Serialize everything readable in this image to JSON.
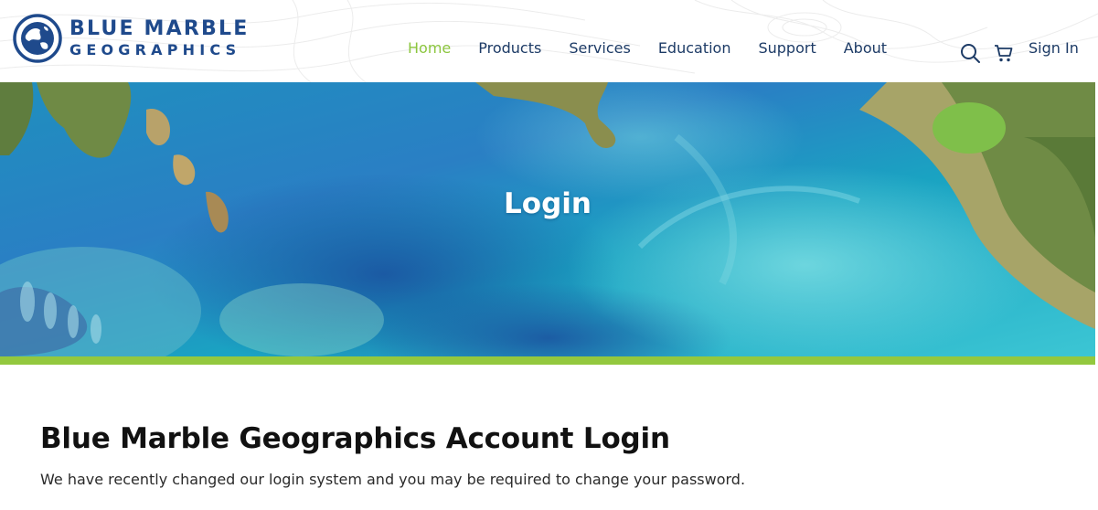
{
  "brand": {
    "logo_line1": "BLUE MARBLE",
    "logo_line2": "GEOGRAPHICS",
    "logo_color": "#1f4a8c"
  },
  "nav": {
    "items": [
      {
        "label": "Home",
        "active": true
      },
      {
        "label": "Products",
        "active": false
      },
      {
        "label": "Services",
        "active": false
      },
      {
        "label": "Education",
        "active": false
      },
      {
        "label": "Support",
        "active": false
      },
      {
        "label": "About",
        "active": false
      }
    ],
    "active_color": "#8cc63f",
    "text_color": "#1d3b66",
    "icons": [
      "search-icon",
      "cart-icon"
    ],
    "signin_label": "Sign In"
  },
  "hero": {
    "title": "Login",
    "accent_color": "#93c83e"
  },
  "content": {
    "heading": "Blue Marble Geographics Account Login",
    "notice": "We have recently changed our login system and you may be required to change your password."
  }
}
